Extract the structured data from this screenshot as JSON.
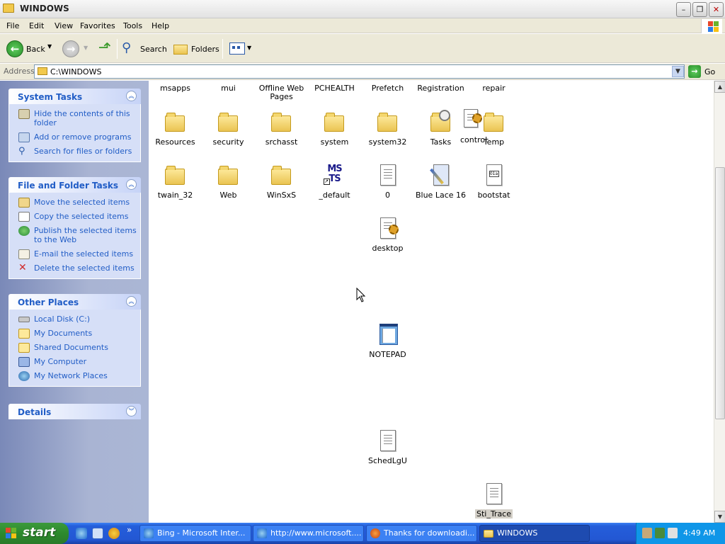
{
  "window": {
    "title": "WINDOWS",
    "controls": {
      "minimize": "–",
      "maximize": "❐",
      "close": "✕"
    }
  },
  "menu": [
    "File",
    "Edit",
    "View",
    "Favorites",
    "Tools",
    "Help"
  ],
  "toolbar": {
    "back_label": "Back",
    "search_label": "Search",
    "folders_label": "Folders"
  },
  "address": {
    "label": "Address",
    "value": "C:\\WINDOWS",
    "go_label": "Go"
  },
  "panels": {
    "system_tasks": {
      "title": "System Tasks",
      "items": [
        {
          "label": "Hide the contents of this folder",
          "icon": "hide-contents-icon"
        },
        {
          "label": "Add or remove programs",
          "icon": "add-remove-programs-icon"
        },
        {
          "label": "Search for files or folders",
          "icon": "search-icon"
        }
      ]
    },
    "file_folder_tasks": {
      "title": "File and Folder Tasks",
      "items": [
        {
          "label": "Move the selected items",
          "icon": "move-icon"
        },
        {
          "label": "Copy the selected items",
          "icon": "copy-icon"
        },
        {
          "label": "Publish the selected items to the Web",
          "icon": "publish-web-icon"
        },
        {
          "label": "E-mail the selected items",
          "icon": "email-icon"
        },
        {
          "label": "Delete the selected items",
          "icon": "delete-icon"
        }
      ]
    },
    "other_places": {
      "title": "Other Places",
      "items": [
        {
          "label": "Local Disk (C:)",
          "icon": "local-disk-icon"
        },
        {
          "label": "My Documents",
          "icon": "my-documents-icon"
        },
        {
          "label": "Shared Documents",
          "icon": "shared-documents-icon"
        },
        {
          "label": "My Computer",
          "icon": "my-computer-icon"
        },
        {
          "label": "My Network Places",
          "icon": "network-places-icon"
        }
      ]
    },
    "details": {
      "title": "Details"
    }
  },
  "files": {
    "row0": [
      "msapps",
      "mui",
      "Offline Web Pages",
      "PCHEALTH",
      "Prefetch",
      "Registration",
      "repair"
    ],
    "resources": "Resources",
    "security": "security",
    "srchasst": "srchasst",
    "system": "system",
    "system32": "system32",
    "tasks": "Tasks",
    "control": "control",
    "temp": "Temp",
    "twain_32": "twain_32",
    "web": "Web",
    "winsxs": "WinSxS",
    "default": "_default",
    "zero": "0",
    "blue_lace": "Blue Lace 16",
    "bootstat": "bootstat",
    "desktop": "desktop",
    "notepad": "NOTEPAD",
    "schedlgu": "SchedLgU",
    "sti_trace": "Sti_Trace",
    "msts_icon_text": "MS TS"
  },
  "taskbar": {
    "start_label": "start",
    "tasks": [
      {
        "label": "Bing - Microsoft Inter...",
        "icon": "ie-icon"
      },
      {
        "label": "http://www.microsoft....",
        "icon": "ie-icon"
      },
      {
        "label": "Thanks for downloadi...",
        "icon": "firefox-icon"
      },
      {
        "label": "WINDOWS",
        "icon": "folder-icon"
      }
    ],
    "clock": "4:49 AM",
    "overflow": "»"
  }
}
